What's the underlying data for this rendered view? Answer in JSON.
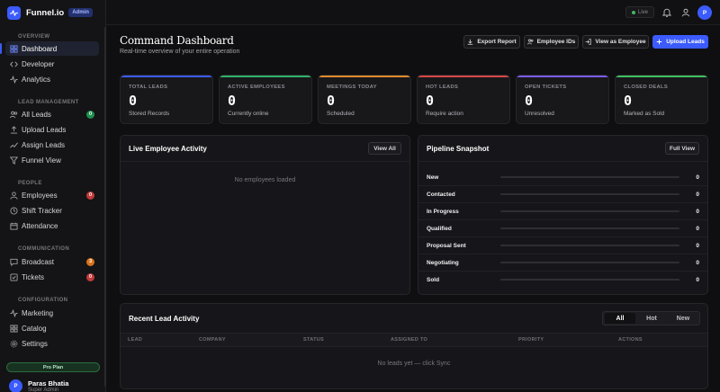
{
  "brand": {
    "name": "Funnel.io",
    "badge": "Admin"
  },
  "sidebar": {
    "sections": {
      "overview": "OVERVIEW",
      "lead_management": "LEAD MANAGEMENT",
      "people": "PEOPLE",
      "communication": "COMMUNICATION",
      "configuration": "CONFIGURATION"
    },
    "items": [
      {
        "label": "Dashboard",
        "active": true
      },
      {
        "label": "Developer"
      },
      {
        "label": "Analytics"
      },
      {
        "label": "All Leads",
        "badge": "0"
      },
      {
        "label": "Upload Leads"
      },
      {
        "label": "Assign Leads"
      },
      {
        "label": "Funnel View"
      },
      {
        "label": "Employees",
        "badge": "0"
      },
      {
        "label": "Shift Tracker"
      },
      {
        "label": "Attendance"
      },
      {
        "label": "Broadcast",
        "badge": "3"
      },
      {
        "label": "Tickets",
        "badge": "0"
      },
      {
        "label": "Marketing"
      },
      {
        "label": "Catalog"
      },
      {
        "label": "Settings"
      }
    ],
    "plan": "Pro Plan",
    "user": {
      "name": "Paras Bhatia",
      "initial": "P",
      "role": "Super Admin"
    }
  },
  "topbar": {
    "status": "Live",
    "avatar_initial": "P"
  },
  "header": {
    "title": "Command Dashboard",
    "subtitle": "Real-time overview of your entire operation",
    "buttons": {
      "export": "Export Report",
      "employee_ids": "Employee IDs",
      "view_as": "View as Employee",
      "upload": "Upload Leads"
    }
  },
  "stats": [
    {
      "label": "TOTAL LEADS",
      "value": "0",
      "desc": "Stored Records",
      "color": "#3b5bfd"
    },
    {
      "label": "ACTIVE EMPLOYEES",
      "value": "0",
      "desc": "Currently online",
      "color": "#2fb36b"
    },
    {
      "label": "MEETINGS TODAY",
      "value": "0",
      "desc": "Scheduled",
      "color": "#e08a2c"
    },
    {
      "label": "HOT LEADS",
      "value": "0",
      "desc": "Require action",
      "color": "#d64545"
    },
    {
      "label": "OPEN TICKETS",
      "value": "0",
      "desc": "Unresolved",
      "color": "#7a5af5"
    },
    {
      "label": "CLOSED DEALS",
      "value": "0",
      "desc": "Marked as Sold",
      "color": "#3fbf5f"
    }
  ],
  "employee_activity": {
    "title": "Live Employee Activity",
    "button": "View All",
    "empty": "No employees loaded"
  },
  "pipeline": {
    "title": "Pipeline Snapshot",
    "button": "Full View",
    "stages": [
      {
        "label": "New",
        "count": "0"
      },
      {
        "label": "Contacted",
        "count": "0"
      },
      {
        "label": "In Progress",
        "count": "0"
      },
      {
        "label": "Qualified",
        "count": "0"
      },
      {
        "label": "Proposal Sent",
        "count": "0"
      },
      {
        "label": "Negotiating",
        "count": "0"
      },
      {
        "label": "Sold",
        "count": "0"
      }
    ]
  },
  "recent_activity": {
    "title": "Recent Lead Activity",
    "filters": [
      "All",
      "Hot",
      "New"
    ],
    "columns": [
      "LEAD",
      "COMPANY",
      "STATUS",
      "ASSIGNED TO",
      "PRIORITY",
      "ACTIONS"
    ],
    "empty": "No leads yet — click Sync"
  }
}
